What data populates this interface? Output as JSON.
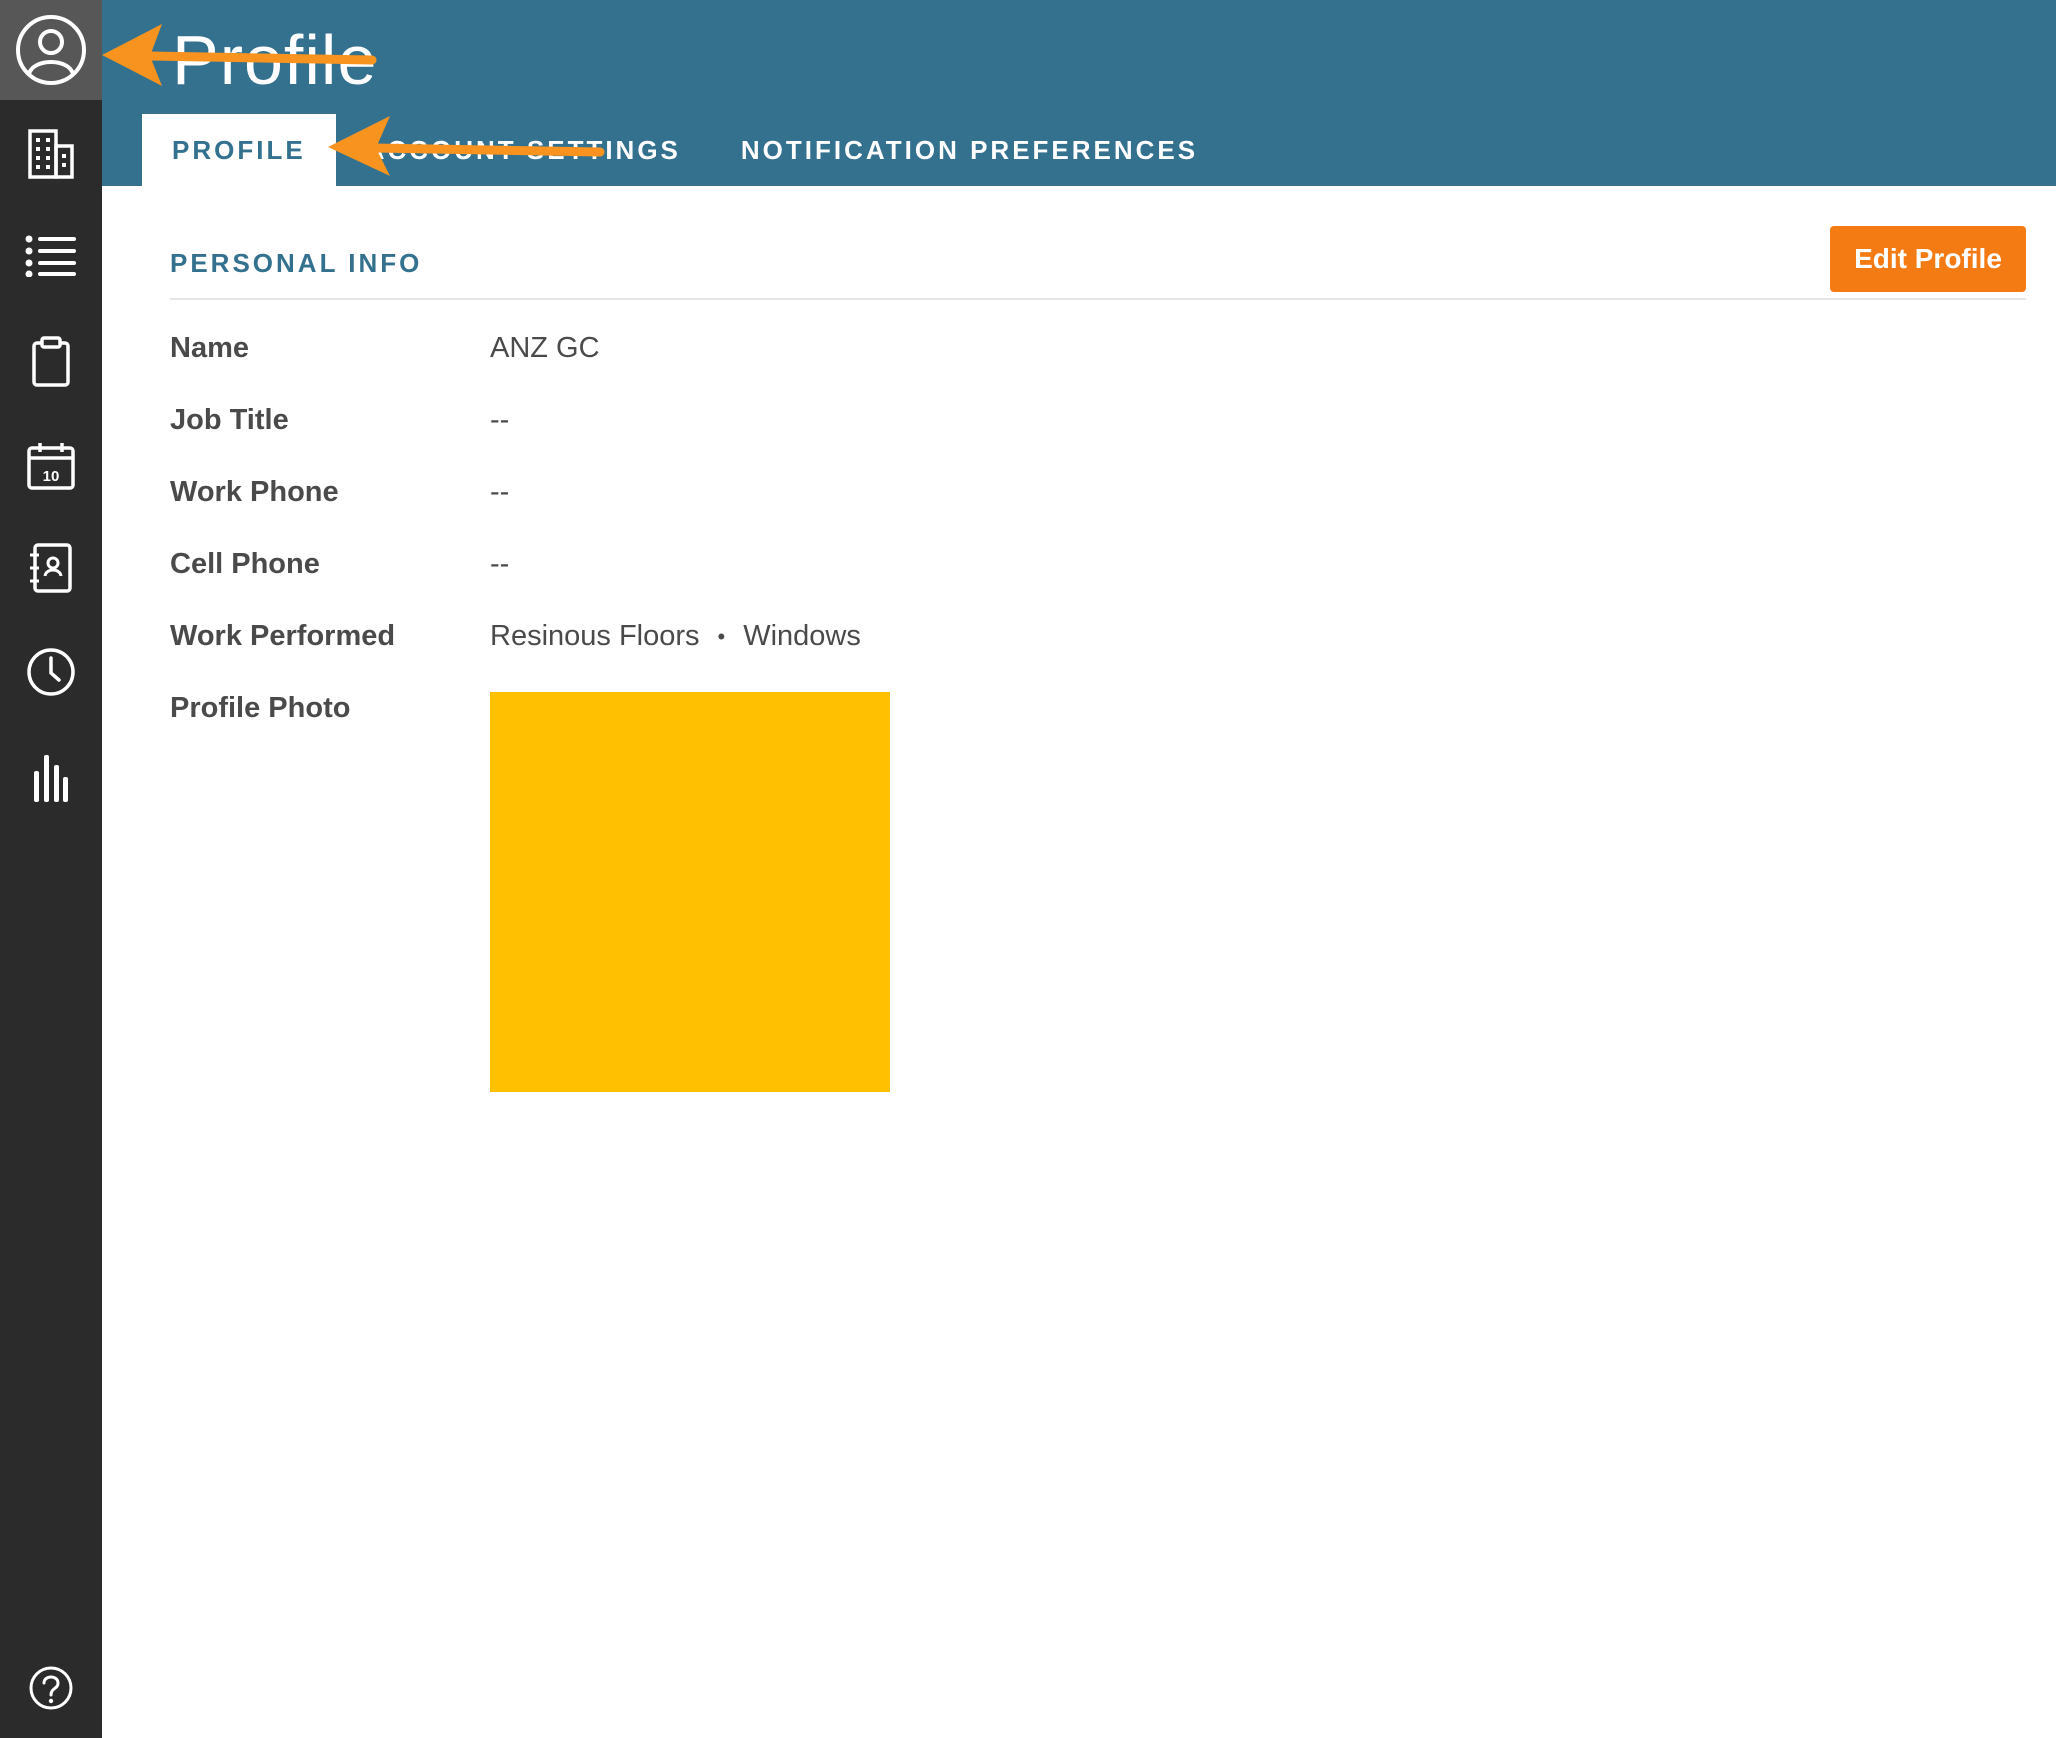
{
  "sidebar": {
    "items": [
      {
        "icon": "user-circle-icon",
        "active": true
      },
      {
        "icon": "building-icon"
      },
      {
        "icon": "list-icon"
      },
      {
        "icon": "clipboard-icon"
      },
      {
        "icon": "calendar-icon",
        "calendar_day": "10"
      },
      {
        "icon": "contact-book-icon"
      },
      {
        "icon": "clock-icon"
      },
      {
        "icon": "bar-chart-icon"
      }
    ],
    "help_icon": "help-circle-icon"
  },
  "header": {
    "title": "Profile",
    "tabs": [
      {
        "label": "PROFILE",
        "active": true
      },
      {
        "label": "ACCOUNT SETTINGS"
      },
      {
        "label": "NOTIFICATION PREFERENCES"
      }
    ]
  },
  "section": {
    "title": "PERSONAL INFO",
    "edit_label": "Edit Profile"
  },
  "fields": {
    "name": {
      "label": "Name",
      "value": "ANZ GC"
    },
    "job_title": {
      "label": "Job Title",
      "value": "--"
    },
    "work_phone": {
      "label": "Work Phone",
      "value": "--"
    },
    "cell_phone": {
      "label": "Cell Phone",
      "value": "--"
    },
    "work_performed": {
      "label": "Work Performed",
      "values": [
        "Resinous Floors",
        "Windows"
      ],
      "separator": "•"
    },
    "profile_photo": {
      "label": "Profile Photo"
    }
  },
  "colors": {
    "header": "#33718f",
    "sidebar": "#2b2b2b",
    "accent": "#f47a14",
    "photo_placeholder": "#fec000",
    "annotation_arrow": "#f7931e"
  }
}
